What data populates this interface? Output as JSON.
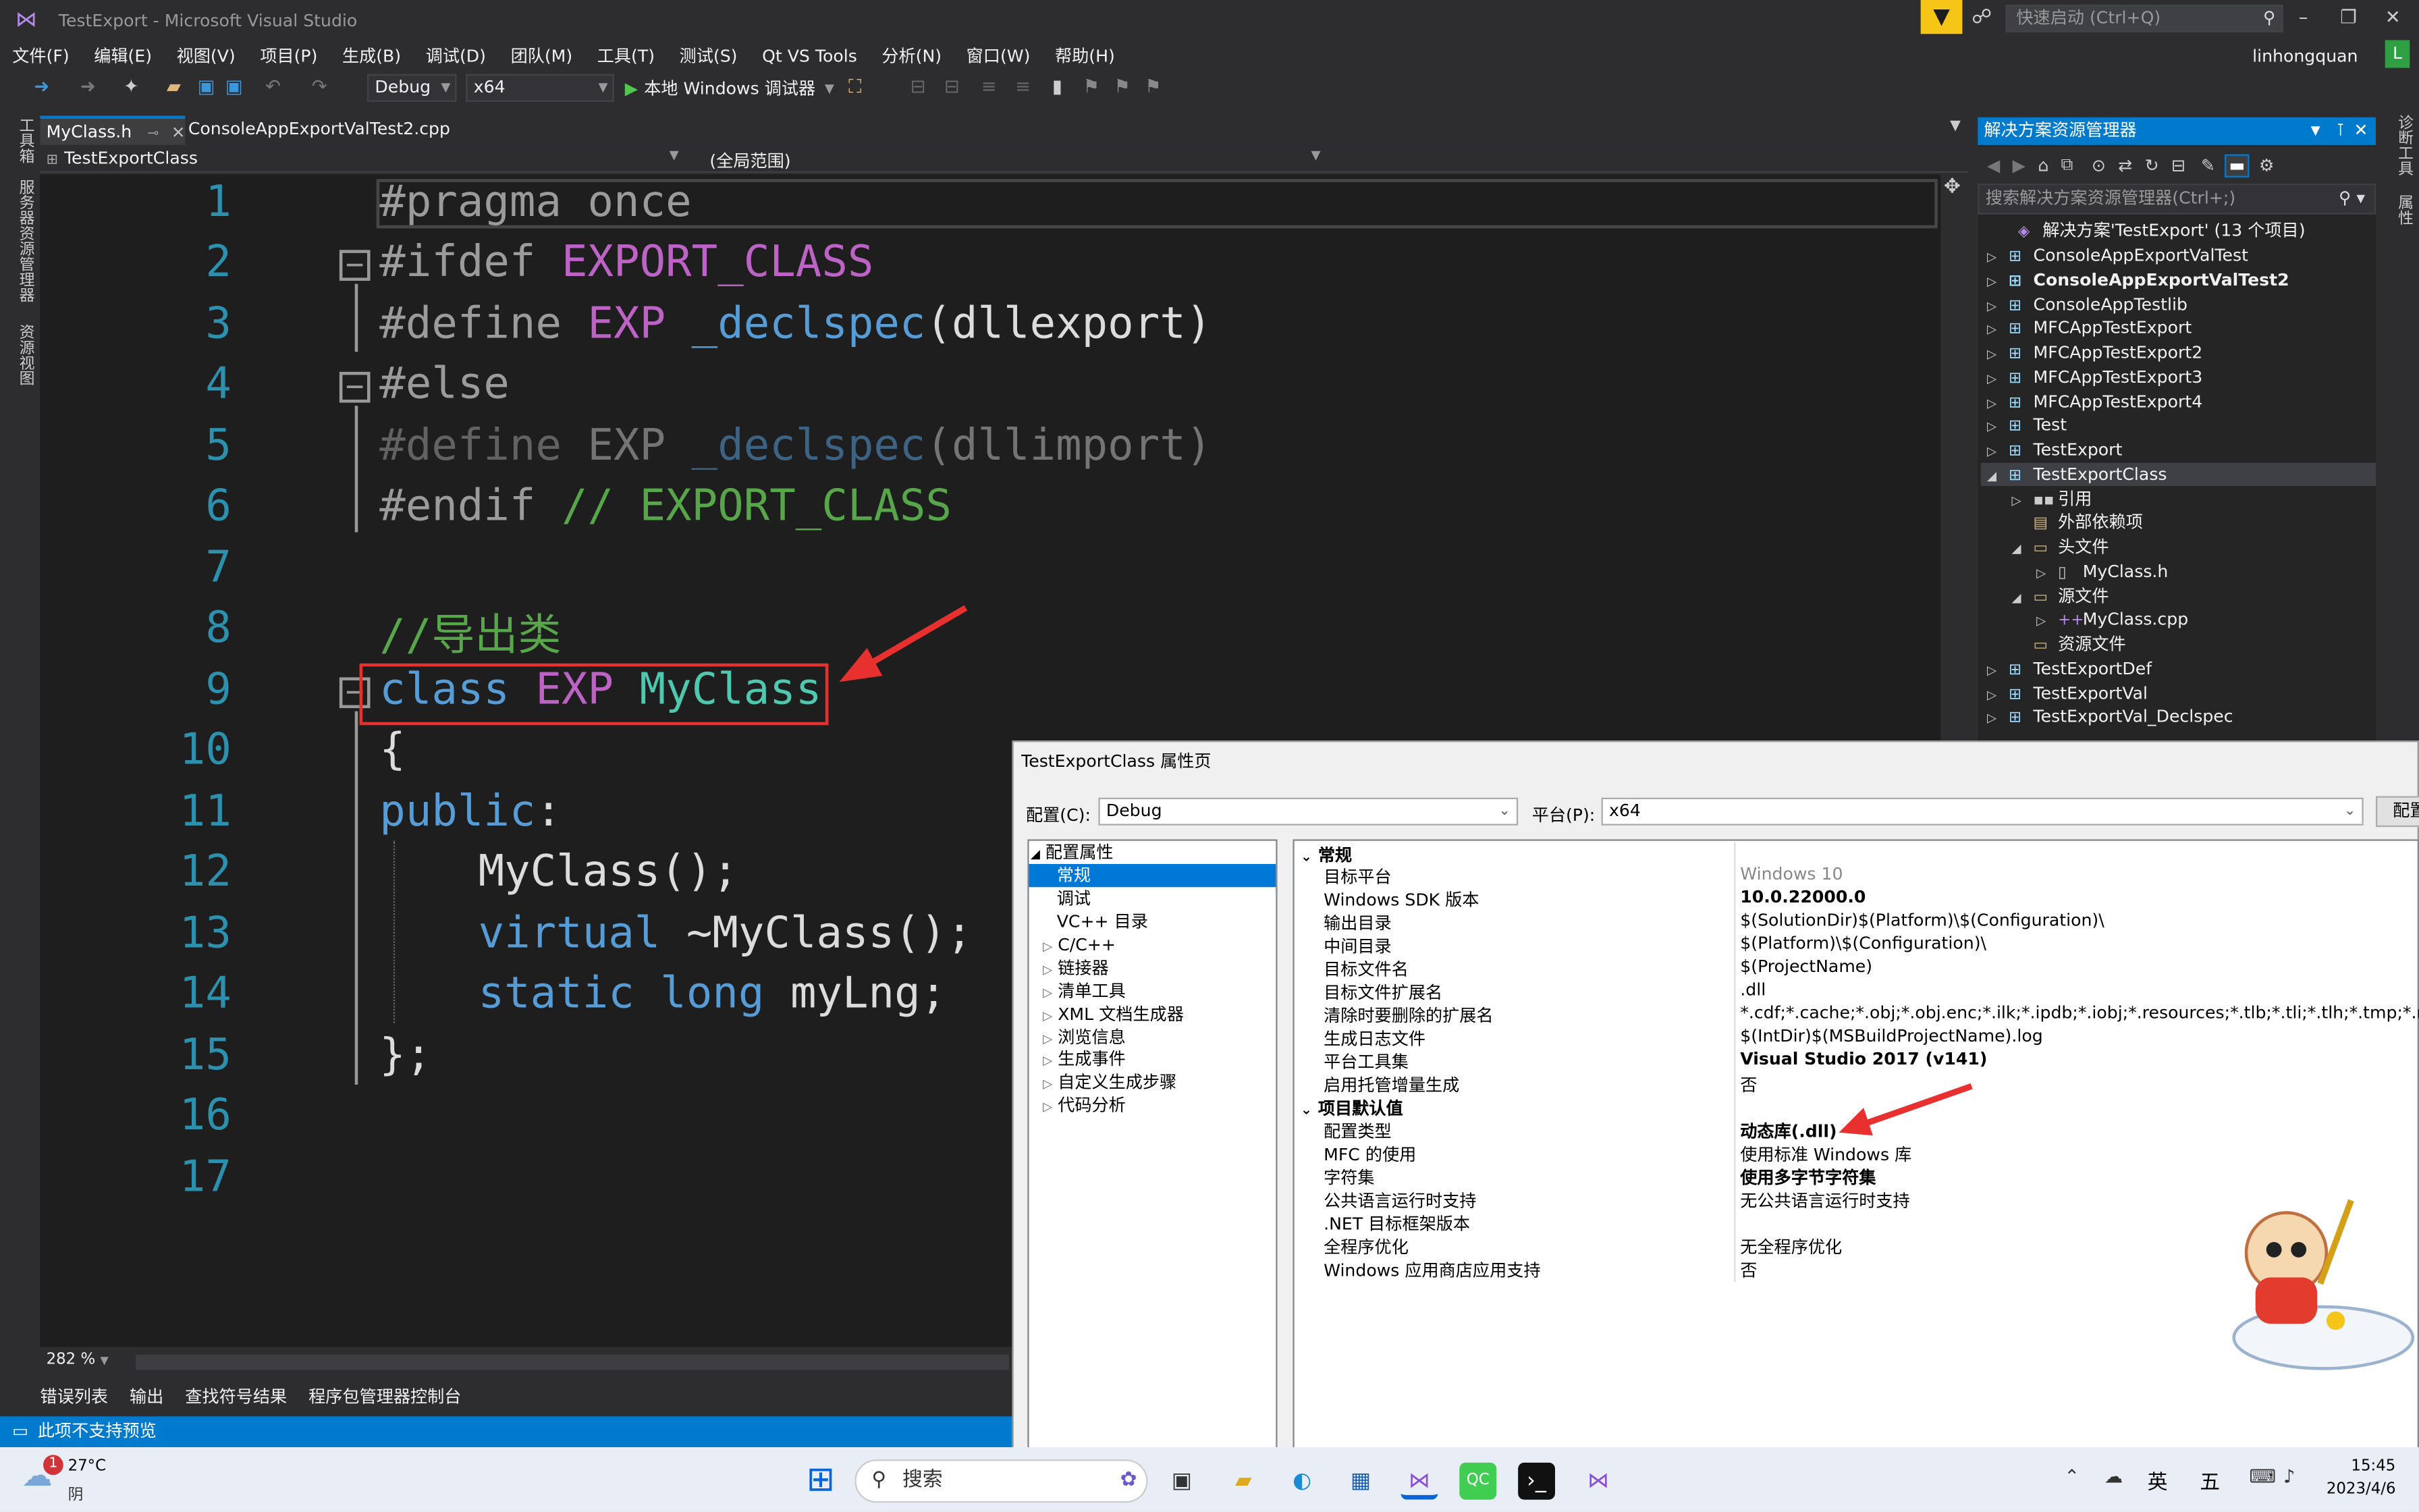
{
  "window": {
    "title": "TestExport - Microsoft Visual Studio",
    "quick_launch_placeholder": "快速启动 (Ctrl+Q)",
    "user": "linhongquan",
    "user_initial": "L"
  },
  "menu": [
    "文件(F)",
    "编辑(E)",
    "视图(V)",
    "项目(P)",
    "生成(B)",
    "调试(D)",
    "团队(M)",
    "工具(T)",
    "测试(S)",
    "Qt VS Tools",
    "分析(N)",
    "窗口(W)",
    "帮助(H)"
  ],
  "toolbar": {
    "config": "Debug",
    "platform": "x64",
    "run_label": "本地 Windows 调试器"
  },
  "left_strip": [
    "工具箱",
    "服务器资源管理器",
    "资源视图"
  ],
  "right_strip": [
    "诊断工具",
    "属性"
  ],
  "editor": {
    "tabs": [
      "MyClass.h",
      "ConsoleAppExportValTest2.cpp"
    ],
    "nav_class": "TestExportClass",
    "nav_scope": "(全局范围)",
    "zoom": "282 %",
    "line_numbers": [
      "1",
      "2",
      "3",
      "4",
      "5",
      "6",
      "7",
      "8",
      "9",
      "10",
      "11",
      "12",
      "13",
      "14",
      "15",
      "16",
      "17"
    ],
    "lines": {
      "l1": "#pragma once",
      "l2a": "#ifdef ",
      "l2b": "EXPORT_CLASS",
      "l3a": "#define ",
      "l3b": "EXP",
      "l3c": " _declspec",
      "l3d": "(dllexport)",
      "l4": "#else",
      "l5a": "#define ",
      "l5b": "EXP",
      "l5c": " _declspec",
      "l5d": "(dllimport)",
      "l6a": "#endif ",
      "l6b": "// EXPORT_CLASS",
      "l8": "//导出类",
      "l9a": "class ",
      "l9b": "EXP ",
      "l9c": "MyClass",
      "l10": "{",
      "l11a": "public",
      "l11b": ":",
      "l12": "MyClass();",
      "l13a": "virtual ",
      "l13b": "~MyClass();",
      "l14a": "static long ",
      "l14b": "myLng;",
      "l15": "};"
    }
  },
  "bottom_tabs": [
    "错误列表",
    "输出",
    "查找符号结果",
    "程序包管理器控制台"
  ],
  "status": "此项不支持预览",
  "solution_explorer": {
    "title": "解决方案资源管理器",
    "search_placeholder": "搜索解决方案资源管理器(Ctrl+;)",
    "items": [
      {
        "label": "解决方案'TestExport' (13 个项目)"
      },
      {
        "label": "ConsoleAppExportValTest"
      },
      {
        "label": "ConsoleAppExportValTest2"
      },
      {
        "label": "ConsoleAppTestlib"
      },
      {
        "label": "MFCAppTestExport"
      },
      {
        "label": "MFCAppTestExport2"
      },
      {
        "label": "MFCAppTestExport3"
      },
      {
        "label": "MFCAppTestExport4"
      },
      {
        "label": "Test"
      },
      {
        "label": "TestExport"
      },
      {
        "label": "TestExportClass"
      },
      {
        "label": "引用"
      },
      {
        "label": "外部依赖项"
      },
      {
        "label": "头文件"
      },
      {
        "label": "MyClass.h"
      },
      {
        "label": "源文件"
      },
      {
        "label": "MyClass.cpp"
      },
      {
        "label": "资源文件"
      },
      {
        "label": "TestExportDef"
      },
      {
        "label": "TestExportVal"
      },
      {
        "label": "TestExportVal_Declspec"
      }
    ]
  },
  "property_page": {
    "title": "TestExportClass 属性页",
    "config_label": "配置(C):",
    "config_value": "Debug",
    "platform_label": "平台(P):",
    "platform_value": "x64",
    "config_manager": "配置",
    "tree": [
      "配置属性",
      "常规",
      "调试",
      "VC++ 目录",
      "C/C++",
      "链接器",
      "清单工具",
      "XML 文档生成器",
      "浏览信息",
      "生成事件",
      "自定义生成步骤",
      "代码分析"
    ],
    "section_general": "常规",
    "section_defaults": "项目默认值",
    "rows": [
      {
        "k": "目标平台",
        "v": "Windows 10"
      },
      {
        "k": "Windows SDK 版本",
        "v": "10.0.22000.0"
      },
      {
        "k": "输出目录",
        "v": "$(SolutionDir)$(Platform)\\$(Configuration)\\"
      },
      {
        "k": "中间目录",
        "v": "$(Platform)\\$(Configuration)\\"
      },
      {
        "k": "目标文件名",
        "v": "$(ProjectName)"
      },
      {
        "k": "目标文件扩展名",
        "v": ".dll"
      },
      {
        "k": "清除时要删除的扩展名",
        "v": "*.cdf;*.cache;*.obj;*.obj.enc;*.ilk;*.ipdb;*.iobj;*.resources;*.tlb;*.tli;*.tlh;*.tmp;*.rsp;*.pgc;*.p"
      },
      {
        "k": "生成日志文件",
        "v": "$(IntDir)$(MSBuildProjectName).log"
      },
      {
        "k": "平台工具集",
        "v": "Visual Studio 2017 (v141)"
      },
      {
        "k": "启用托管增量生成",
        "v": "否"
      },
      {
        "k": "配置类型",
        "v": "动态库(.dll)"
      },
      {
        "k": "MFC 的使用",
        "v": "使用标准 Windows 库"
      },
      {
        "k": "字符集",
        "v": "使用多字节字符集"
      },
      {
        "k": "公共语言运行时支持",
        "v": "无公共语言运行时支持"
      },
      {
        "k": ".NET 目标框架版本",
        "v": ""
      },
      {
        "k": "全程序优化",
        "v": "无全程序优化"
      },
      {
        "k": "Windows 应用商店应用支持",
        "v": "否"
      }
    ]
  },
  "taskbar": {
    "weather_temp": "27°C",
    "weather_desc": "阴",
    "weather_badge": "1",
    "search": "搜索",
    "ime1": "英",
    "ime2": "五",
    "time": "15:45",
    "date": "2023/4/6"
  },
  "colors": {
    "accent": "#007acc",
    "editor_bg": "#1e1e1e",
    "annotation_red": "#e8302f"
  }
}
